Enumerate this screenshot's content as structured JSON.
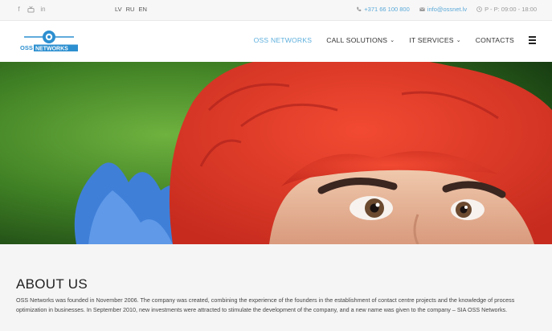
{
  "topbar": {
    "social": [
      "facebook-icon",
      "youtube-icon",
      "linkedin-icon"
    ],
    "languages": [
      "LV",
      "RU",
      "EN"
    ],
    "phone": "+371 66 100 800",
    "email": "info@ossnet.lv",
    "hours": "P - P: 09:00 - 18:00"
  },
  "logo": {
    "top": "OSS",
    "bottom": "NETWORKS"
  },
  "nav": {
    "items": [
      {
        "label": "OSS NETWORKS",
        "active": true,
        "dropdown": false
      },
      {
        "label": "CALL SOLUTIONS",
        "active": false,
        "dropdown": true
      },
      {
        "label": "IT SERVICES",
        "active": false,
        "dropdown": true
      },
      {
        "label": "CONTACTS",
        "active": false,
        "dropdown": false
      }
    ],
    "menu_icon": "hamburger-icon"
  },
  "about": {
    "title": "ABOUT US",
    "text": "OSS Networks was founded in November 2006. The company was created, combining the experience of the founders in the establishment of contact centre projects and the knowledge of process optimization in businesses. In September 2010, new investments were attracted to stimulate the development of the company, and a new name was given to the company – SIA OSS Networks."
  },
  "colors": {
    "accent": "#5fb0dd",
    "logo_blue": "#2c8fd0",
    "hair_red": "#e63a2a",
    "background": "#f5f5f5"
  }
}
